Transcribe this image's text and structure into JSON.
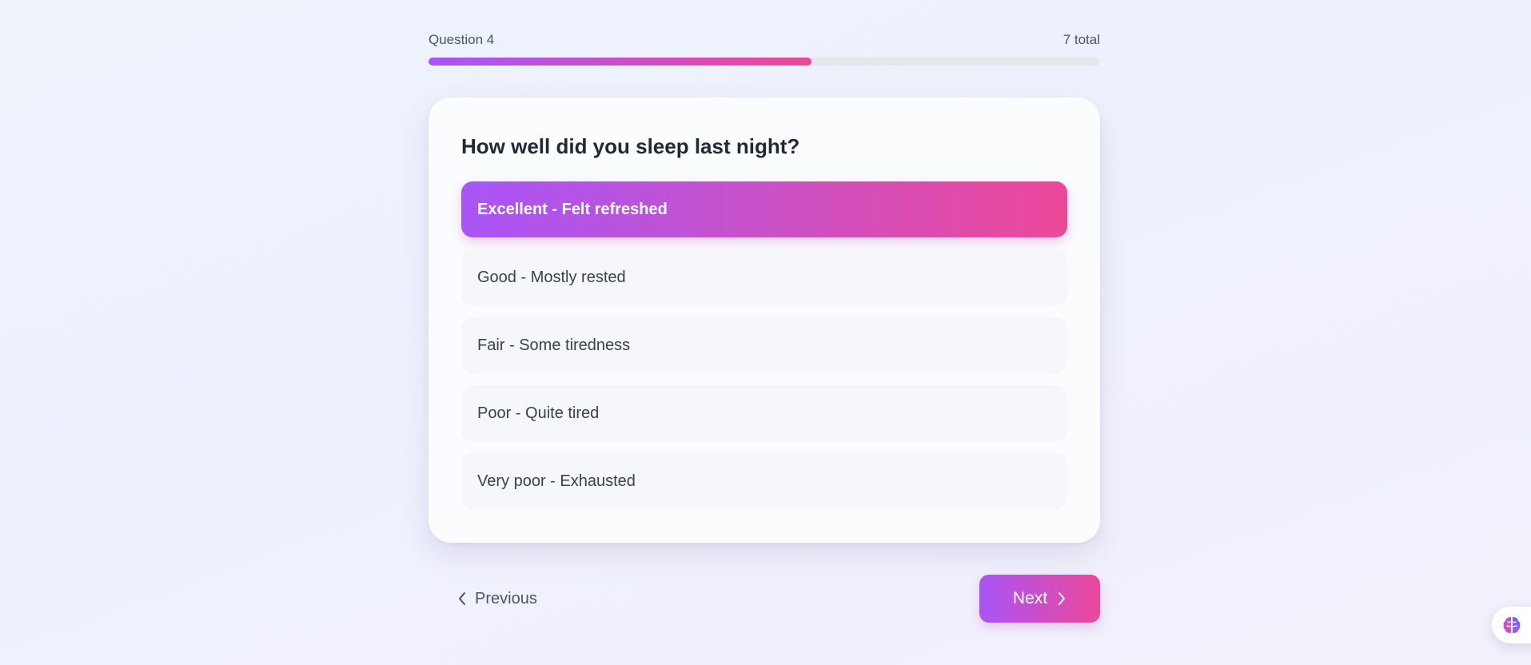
{
  "progress": {
    "label": "Question 4",
    "total_label": "7 total",
    "fraction": 0.57
  },
  "question": {
    "text": "How well did you sleep last night?"
  },
  "options": [
    {
      "label": "Excellent - Felt refreshed",
      "selected": true
    },
    {
      "label": "Good - Mostly rested",
      "selected": false
    },
    {
      "label": "Fair - Some tiredness",
      "selected": false
    },
    {
      "label": "Poor - Quite tired",
      "selected": false
    },
    {
      "label": "Very poor - Exhausted",
      "selected": false
    }
  ],
  "nav": {
    "previous_label": "Previous",
    "next_label": "Next"
  },
  "icons": {
    "previous": "chevron-left-icon",
    "next": "chevron-right-icon",
    "assistant": "brain-icon"
  },
  "colors": {
    "accent_start": "#a855f7",
    "accent_end": "#ec4899"
  }
}
